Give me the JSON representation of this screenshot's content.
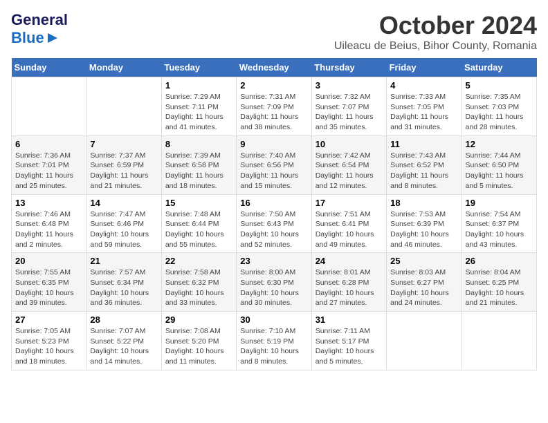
{
  "logo": {
    "line1": "General",
    "line2": "Blue"
  },
  "title": "October 2024",
  "location": "Uileacu de Beius, Bihor County, Romania",
  "weekdays": [
    "Sunday",
    "Monday",
    "Tuesday",
    "Wednesday",
    "Thursday",
    "Friday",
    "Saturday"
  ],
  "weeks": [
    [
      {
        "day": "",
        "info": ""
      },
      {
        "day": "",
        "info": ""
      },
      {
        "day": "1",
        "info": "Sunrise: 7:29 AM\nSunset: 7:11 PM\nDaylight: 11 hours and 41 minutes."
      },
      {
        "day": "2",
        "info": "Sunrise: 7:31 AM\nSunset: 7:09 PM\nDaylight: 11 hours and 38 minutes."
      },
      {
        "day": "3",
        "info": "Sunrise: 7:32 AM\nSunset: 7:07 PM\nDaylight: 11 hours and 35 minutes."
      },
      {
        "day": "4",
        "info": "Sunrise: 7:33 AM\nSunset: 7:05 PM\nDaylight: 11 hours and 31 minutes."
      },
      {
        "day": "5",
        "info": "Sunrise: 7:35 AM\nSunset: 7:03 PM\nDaylight: 11 hours and 28 minutes."
      }
    ],
    [
      {
        "day": "6",
        "info": "Sunrise: 7:36 AM\nSunset: 7:01 PM\nDaylight: 11 hours and 25 minutes."
      },
      {
        "day": "7",
        "info": "Sunrise: 7:37 AM\nSunset: 6:59 PM\nDaylight: 11 hours and 21 minutes."
      },
      {
        "day": "8",
        "info": "Sunrise: 7:39 AM\nSunset: 6:58 PM\nDaylight: 11 hours and 18 minutes."
      },
      {
        "day": "9",
        "info": "Sunrise: 7:40 AM\nSunset: 6:56 PM\nDaylight: 11 hours and 15 minutes."
      },
      {
        "day": "10",
        "info": "Sunrise: 7:42 AM\nSunset: 6:54 PM\nDaylight: 11 hours and 12 minutes."
      },
      {
        "day": "11",
        "info": "Sunrise: 7:43 AM\nSunset: 6:52 PM\nDaylight: 11 hours and 8 minutes."
      },
      {
        "day": "12",
        "info": "Sunrise: 7:44 AM\nSunset: 6:50 PM\nDaylight: 11 hours and 5 minutes."
      }
    ],
    [
      {
        "day": "13",
        "info": "Sunrise: 7:46 AM\nSunset: 6:48 PM\nDaylight: 11 hours and 2 minutes."
      },
      {
        "day": "14",
        "info": "Sunrise: 7:47 AM\nSunset: 6:46 PM\nDaylight: 10 hours and 59 minutes."
      },
      {
        "day": "15",
        "info": "Sunrise: 7:48 AM\nSunset: 6:44 PM\nDaylight: 10 hours and 55 minutes."
      },
      {
        "day": "16",
        "info": "Sunrise: 7:50 AM\nSunset: 6:43 PM\nDaylight: 10 hours and 52 minutes."
      },
      {
        "day": "17",
        "info": "Sunrise: 7:51 AM\nSunset: 6:41 PM\nDaylight: 10 hours and 49 minutes."
      },
      {
        "day": "18",
        "info": "Sunrise: 7:53 AM\nSunset: 6:39 PM\nDaylight: 10 hours and 46 minutes."
      },
      {
        "day": "19",
        "info": "Sunrise: 7:54 AM\nSunset: 6:37 PM\nDaylight: 10 hours and 43 minutes."
      }
    ],
    [
      {
        "day": "20",
        "info": "Sunrise: 7:55 AM\nSunset: 6:35 PM\nDaylight: 10 hours and 39 minutes."
      },
      {
        "day": "21",
        "info": "Sunrise: 7:57 AM\nSunset: 6:34 PM\nDaylight: 10 hours and 36 minutes."
      },
      {
        "day": "22",
        "info": "Sunrise: 7:58 AM\nSunset: 6:32 PM\nDaylight: 10 hours and 33 minutes."
      },
      {
        "day": "23",
        "info": "Sunrise: 8:00 AM\nSunset: 6:30 PM\nDaylight: 10 hours and 30 minutes."
      },
      {
        "day": "24",
        "info": "Sunrise: 8:01 AM\nSunset: 6:28 PM\nDaylight: 10 hours and 27 minutes."
      },
      {
        "day": "25",
        "info": "Sunrise: 8:03 AM\nSunset: 6:27 PM\nDaylight: 10 hours and 24 minutes."
      },
      {
        "day": "26",
        "info": "Sunrise: 8:04 AM\nSunset: 6:25 PM\nDaylight: 10 hours and 21 minutes."
      }
    ],
    [
      {
        "day": "27",
        "info": "Sunrise: 7:05 AM\nSunset: 5:23 PM\nDaylight: 10 hours and 18 minutes."
      },
      {
        "day": "28",
        "info": "Sunrise: 7:07 AM\nSunset: 5:22 PM\nDaylight: 10 hours and 14 minutes."
      },
      {
        "day": "29",
        "info": "Sunrise: 7:08 AM\nSunset: 5:20 PM\nDaylight: 10 hours and 11 minutes."
      },
      {
        "day": "30",
        "info": "Sunrise: 7:10 AM\nSunset: 5:19 PM\nDaylight: 10 hours and 8 minutes."
      },
      {
        "day": "31",
        "info": "Sunrise: 7:11 AM\nSunset: 5:17 PM\nDaylight: 10 hours and 5 minutes."
      },
      {
        "day": "",
        "info": ""
      },
      {
        "day": "",
        "info": ""
      }
    ]
  ]
}
